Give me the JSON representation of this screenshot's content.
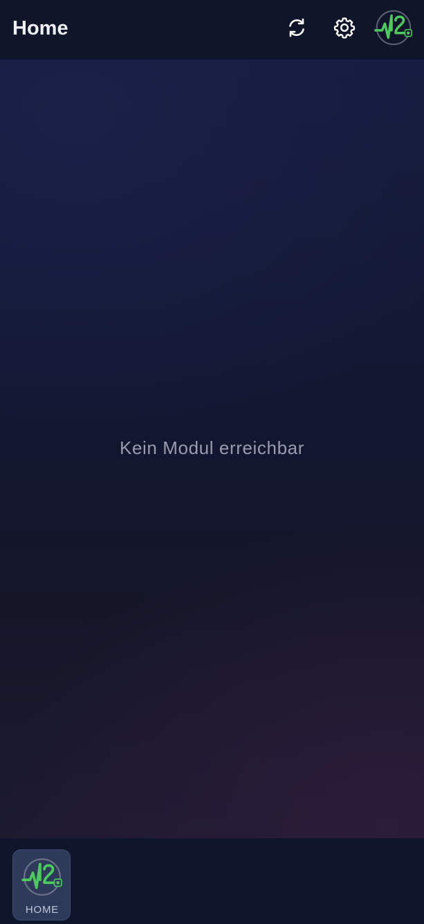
{
  "header": {
    "title": "Home",
    "actions": [
      {
        "icon": "refresh-icon",
        "label": "refresh"
      },
      {
        "icon": "gear-icon",
        "label": "settings"
      },
      {
        "icon": "app-logo-icon",
        "label": "logo"
      }
    ]
  },
  "main": {
    "empty_message": "Kein Modul erreichbar"
  },
  "bottom_nav": {
    "items": [
      {
        "label": "HOME",
        "icon": "app-logo-icon",
        "active": true
      }
    ]
  },
  "colors": {
    "background": "#10162a",
    "logo_green": "#4ccb5c",
    "active_tab": "#2d3a5a",
    "text_primary": "#eef0f6",
    "text_muted": "#9a9bae"
  }
}
